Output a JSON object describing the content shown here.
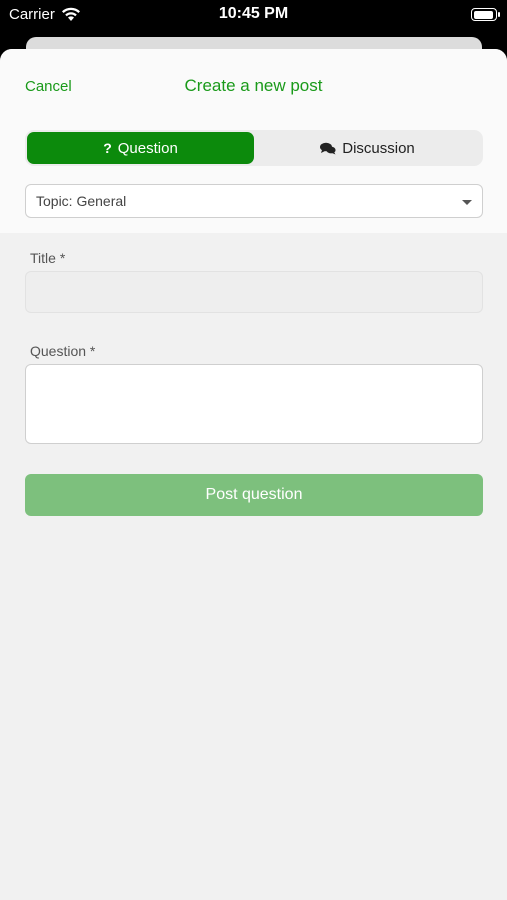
{
  "status_bar": {
    "carrier": "Carrier",
    "time": "10:45 PM"
  },
  "nav": {
    "cancel": "Cancel",
    "title": "Create a new post"
  },
  "segments": [
    {
      "label": "Question",
      "icon": "question-mark-icon",
      "active": true
    },
    {
      "label": "Discussion",
      "icon": "chat-bubbles-icon",
      "active": false
    }
  ],
  "topic": {
    "value": "Topic: General"
  },
  "title_field": {
    "label": "Title *",
    "value": ""
  },
  "question_field": {
    "label": "Question *",
    "value": ""
  },
  "post_button": {
    "label": "Post question"
  },
  "colors": {
    "accent": "#0c8a0c",
    "accent_text": "#1a9a1a",
    "button_disabled": "#7dc07d"
  }
}
